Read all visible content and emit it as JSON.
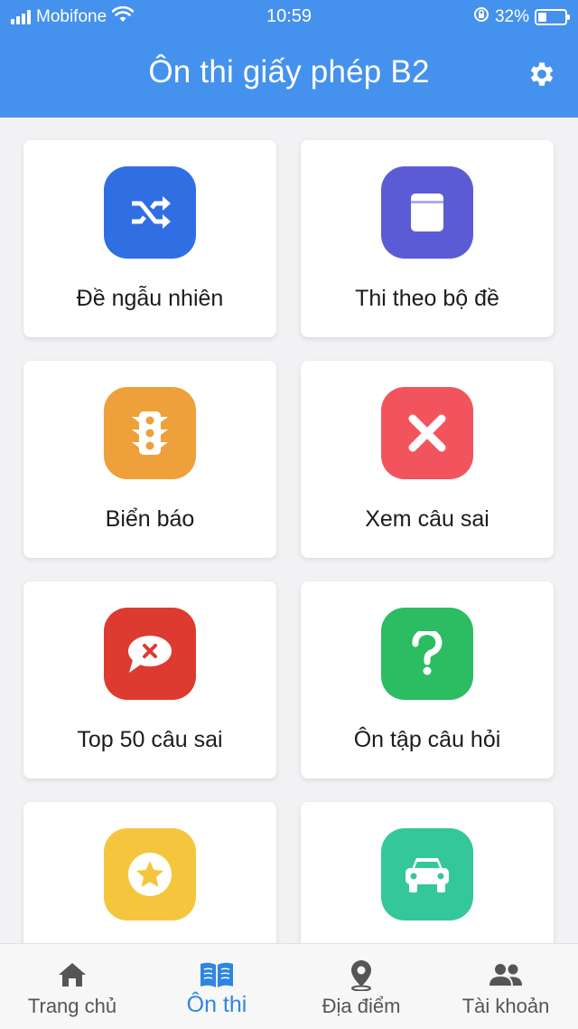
{
  "status_bar": {
    "carrier": "Mobifone",
    "time": "10:59",
    "battery_percent": "32%",
    "battery_level": 0.32
  },
  "header": {
    "title": "Ôn thi giấy phép B2",
    "settings_icon": "gear-icon",
    "color": "#4591ee"
  },
  "menu": {
    "items": [
      {
        "label": "Đề ngẫu nhiên",
        "icon": "shuffle-icon",
        "color": "#2f6fe3"
      },
      {
        "label": "Thi theo bộ đề",
        "icon": "book-icon",
        "color": "#5b5bd6"
      },
      {
        "label": "Biển báo",
        "icon": "traffic-light-icon",
        "color": "#eea03a"
      },
      {
        "label": "Xem câu sai",
        "icon": "close-icon",
        "color": "#f2545e"
      },
      {
        "label": "Top 50 câu sai",
        "icon": "chat-error-icon",
        "color": "#dd3b2f"
      },
      {
        "label": "Ôn tập câu hỏi",
        "icon": "question-icon",
        "color": "#2cbc62"
      },
      {
        "label": "",
        "icon": "star-icon",
        "color": "#f5c63d"
      },
      {
        "label": "",
        "icon": "car-icon",
        "color": "#34c79a"
      }
    ]
  },
  "tabbar": {
    "active_color": "#2f86e0",
    "tabs": [
      {
        "label": "Trang chủ",
        "icon": "home-icon"
      },
      {
        "label": "Ôn thi",
        "icon": "open-book-icon"
      },
      {
        "label": "Địa điểm",
        "icon": "map-pin-icon"
      },
      {
        "label": "Tài khoản",
        "icon": "users-icon"
      }
    ]
  }
}
